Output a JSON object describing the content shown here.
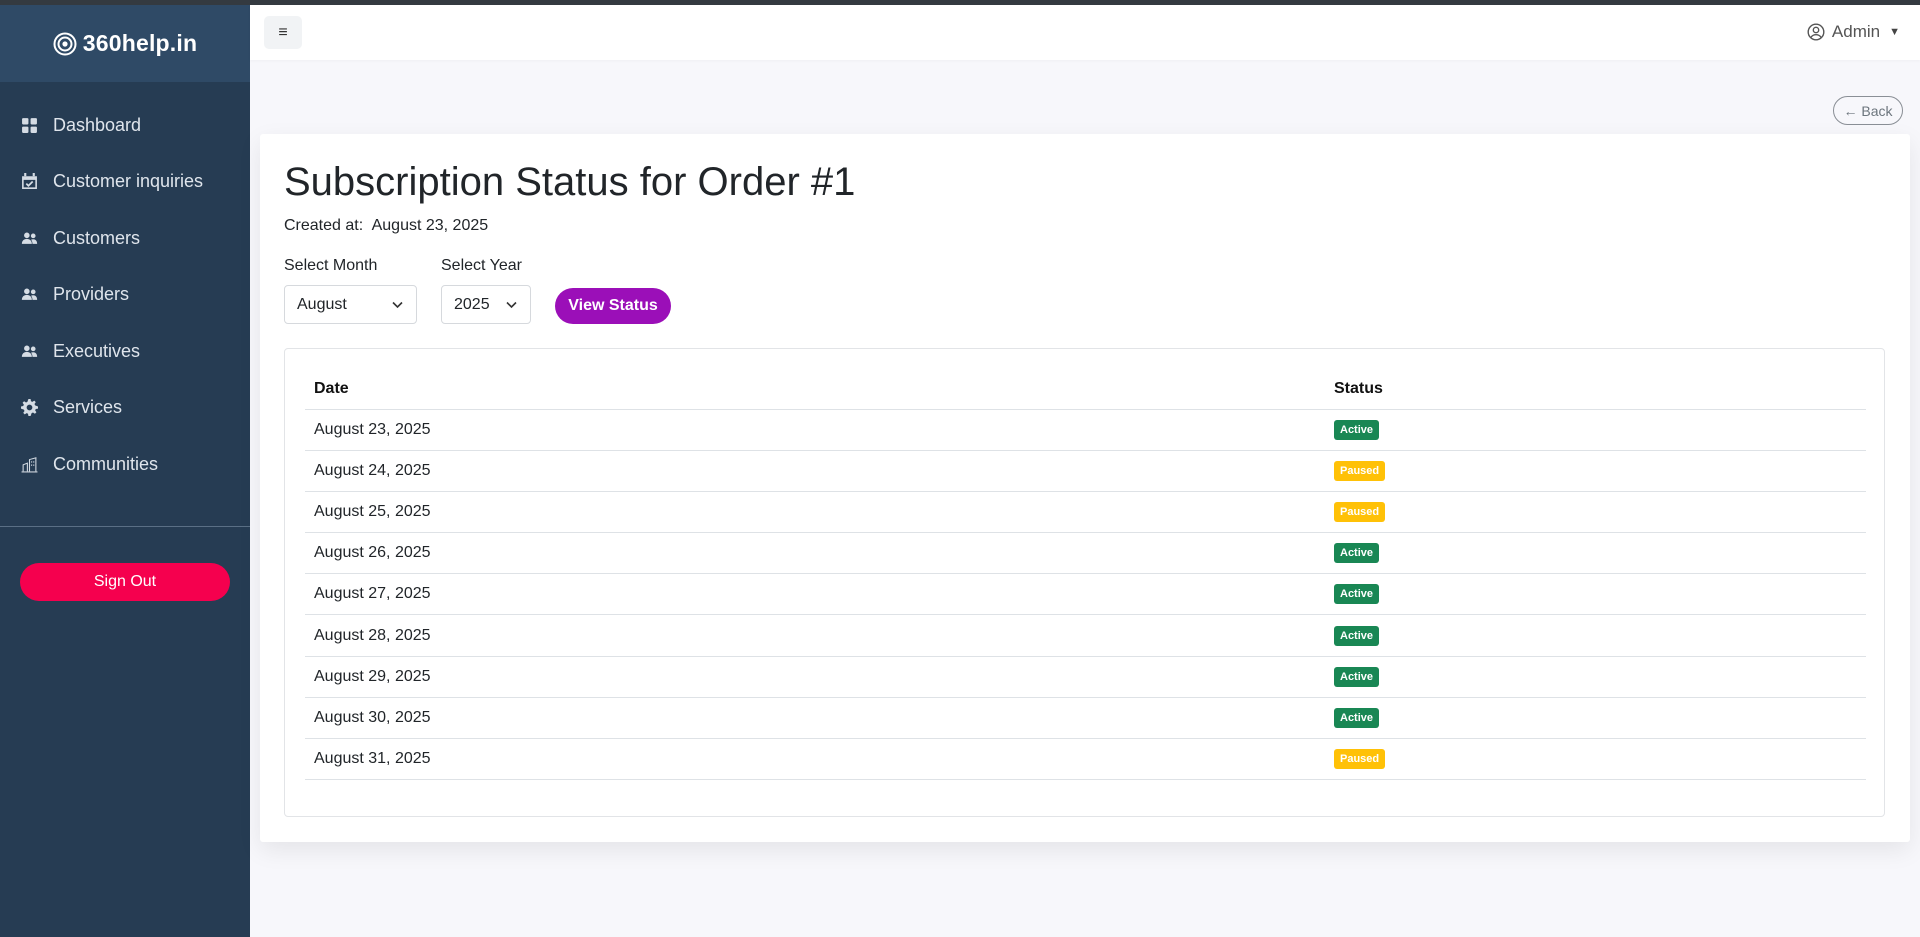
{
  "brand": {
    "name": "360help.in"
  },
  "sidebar": {
    "items": [
      {
        "label": "Dashboard",
        "icon": "dashboard-icon"
      },
      {
        "label": "Customer inquiries",
        "icon": "calendar-check-icon"
      },
      {
        "label": "Customers",
        "icon": "users-icon"
      },
      {
        "label": "Providers",
        "icon": "users-icon"
      },
      {
        "label": "Executives",
        "icon": "users-icon"
      },
      {
        "label": "Services",
        "icon": "gear-icon"
      },
      {
        "label": "Communities",
        "icon": "buildings-icon"
      }
    ],
    "signout_label": "Sign Out"
  },
  "topbar": {
    "menu_icon": "≡",
    "user_label": "Admin"
  },
  "back_label": "← Back",
  "page": {
    "title": "Subscription Status for Order #1",
    "created_label": "Created at:",
    "created_value": "August 23, 2025"
  },
  "filters": {
    "month_label": "Select Month",
    "month_value": "August",
    "year_label": "Select Year",
    "year_value": "2025",
    "view_label": "View Status"
  },
  "table": {
    "headers": [
      "Date",
      "Status"
    ],
    "rows": [
      {
        "date": "August 23, 2025",
        "status": "Active"
      },
      {
        "date": "August 24, 2025",
        "status": "Paused"
      },
      {
        "date": "August 25, 2025",
        "status": "Paused"
      },
      {
        "date": "August 26, 2025",
        "status": "Active"
      },
      {
        "date": "August 27, 2025",
        "status": "Active"
      },
      {
        "date": "August 28, 2025",
        "status": "Active"
      },
      {
        "date": "August 29, 2025",
        "status": "Active"
      },
      {
        "date": "August 30, 2025",
        "status": "Active"
      },
      {
        "date": "August 31, 2025",
        "status": "Paused"
      }
    ]
  },
  "colors": {
    "sidebar_bg": "#263c53",
    "active": "#198754",
    "paused": "#ffc107",
    "accent": "#9b0fb8",
    "signout": "#f5004e"
  }
}
